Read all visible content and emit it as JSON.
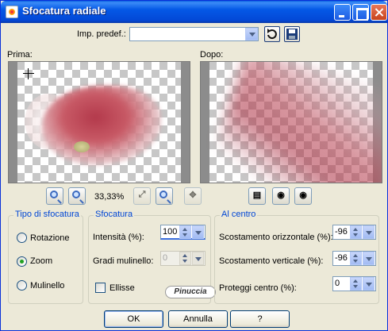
{
  "window": {
    "title": "Sfocatura radiale"
  },
  "preset": {
    "label": "Imp. predef.:",
    "value": ""
  },
  "preview": {
    "before_label": "Prima:",
    "after_label": "Dopo:",
    "zoom": "33,33%"
  },
  "blur_type": {
    "title": "Tipo di sfocatura",
    "options": [
      "Rotazione",
      "Zoom",
      "Mulinello"
    ],
    "selected": "Zoom"
  },
  "blur": {
    "title": "Sfocatura",
    "intensity_label": "Intensità (%):",
    "intensity_value": "100",
    "twist_label": "Gradi mulinello:",
    "twist_value": "0",
    "ellipse_label": "Ellisse",
    "ellipse_checked": false
  },
  "center": {
    "title": "Al centro",
    "h_offset_label": "Scostamento orizzontale (%):",
    "h_offset_value": "-96",
    "v_offset_label": "Scostamento verticale (%):",
    "v_offset_value": "-96",
    "protect_label": "Proteggi centro (%):",
    "protect_value": "0"
  },
  "watermark": {
    "text": "Pinuccia"
  },
  "buttons": {
    "ok": "OK",
    "cancel": "Annulla",
    "help": "?"
  },
  "colors": {
    "title_blue": "#0458e6",
    "group_title": "#0046d5",
    "dialog_bg": "#ece9d8"
  }
}
